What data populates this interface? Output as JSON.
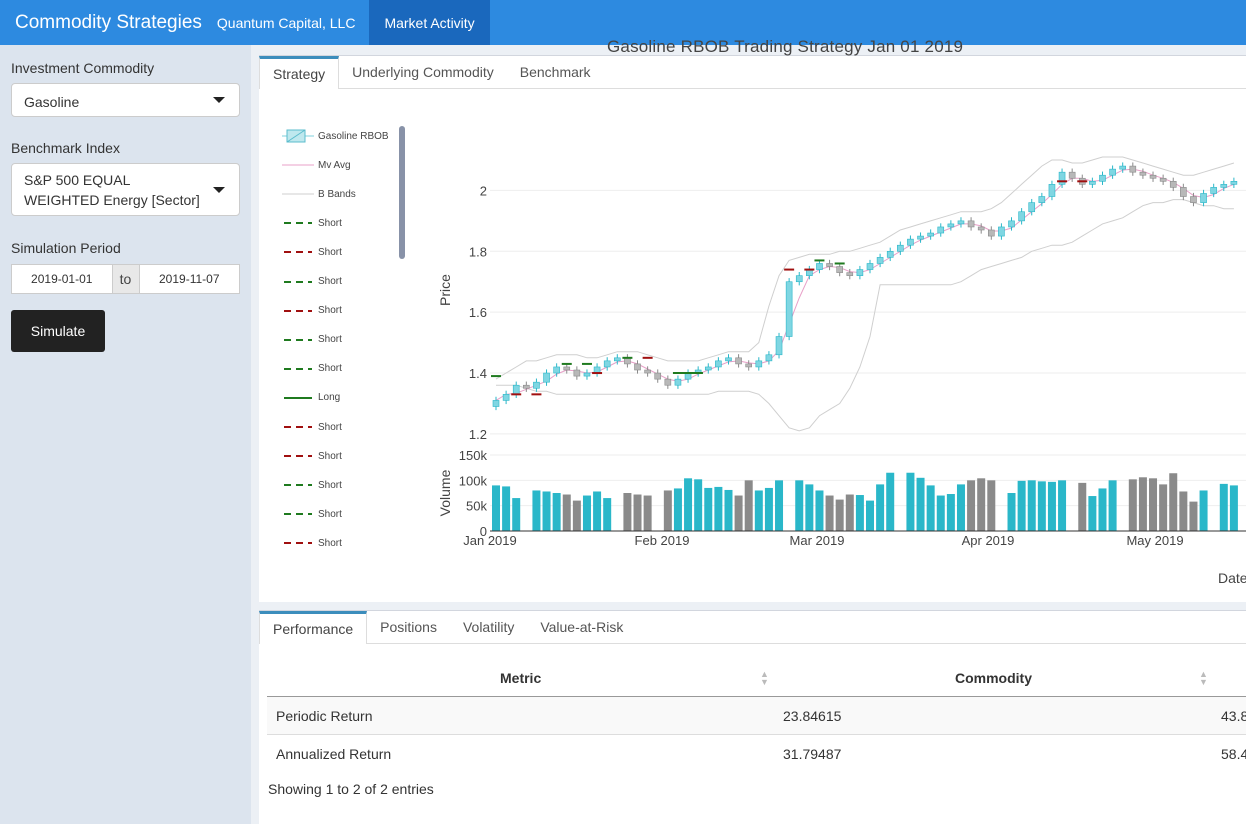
{
  "header": {
    "brand": "Commodity Strategies",
    "company": "Quantum Capital, LLC",
    "nav_active": "Market Activity"
  },
  "sidebar": {
    "commodity_label": "Investment Commodity",
    "commodity_value": "Gasoline",
    "benchmark_label": "Benchmark Index",
    "benchmark_value": "S&P 500 EQUAL WEIGHTED Energy [Sector]",
    "period_label": "Simulation Period",
    "start_date": "2019-01-01",
    "to_label": "to",
    "end_date": "2019-11-07",
    "simulate_label": "Simulate"
  },
  "chart_tabs": [
    "Strategy",
    "Underlying Commodity",
    "Benchmark"
  ],
  "chart_title": "Gasoline RBOB  Trading Strategy  Jan 01 2019",
  "legend": [
    {
      "label": "Gasoline RBOB",
      "style": "candle"
    },
    {
      "label": "Mv Avg",
      "style": "pink"
    },
    {
      "label": "B Bands",
      "style": "grey"
    },
    {
      "label": "Short",
      "style": "green-dash"
    },
    {
      "label": "Short",
      "style": "red-dash"
    },
    {
      "label": "Short",
      "style": "green-dash"
    },
    {
      "label": "Short",
      "style": "red-dash"
    },
    {
      "label": "Short",
      "style": "green-dash"
    },
    {
      "label": "Short",
      "style": "green-dash"
    },
    {
      "label": "Long",
      "style": "green-solid"
    },
    {
      "label": "Short",
      "style": "red-dash"
    },
    {
      "label": "Short",
      "style": "red-dash"
    },
    {
      "label": "Short",
      "style": "green-dash"
    },
    {
      "label": "Short",
      "style": "green-dash"
    },
    {
      "label": "Short",
      "style": "red-dash"
    }
  ],
  "chart_data": {
    "type": "candlestick",
    "ylabel": "Price",
    "volume_label": "Volume",
    "xlabel": "Date",
    "x_ticks": [
      "Jan 2019",
      "Feb 2019",
      "Mar 2019",
      "Apr 2019",
      "May 2019"
    ],
    "y_ticks": [
      "1.2",
      "1.4",
      "1.6",
      "1.8",
      "2"
    ],
    "ylim": [
      1.18,
      2.1
    ],
    "vol_ticks": [
      "0",
      "50k",
      "100k",
      "150k"
    ],
    "vol_ylim": [
      0,
      150000
    ],
    "colors": {
      "up": "#2ab7c9",
      "down": "#8a8a8a",
      "ma": "#e8a0c8",
      "band": "#cfcfcf",
      "short_green": "#1f7a1f",
      "short_red": "#a01010"
    },
    "close_series": [
      1.31,
      1.33,
      1.36,
      1.35,
      1.37,
      1.4,
      1.42,
      1.41,
      1.39,
      1.4,
      1.42,
      1.44,
      1.45,
      1.43,
      1.41,
      1.4,
      1.38,
      1.36,
      1.38,
      1.4,
      1.41,
      1.42,
      1.44,
      1.45,
      1.43,
      1.42,
      1.44,
      1.46,
      1.52,
      1.7,
      1.72,
      1.74,
      1.76,
      1.75,
      1.73,
      1.72,
      1.74,
      1.76,
      1.78,
      1.8,
      1.82,
      1.84,
      1.85,
      1.86,
      1.88,
      1.89,
      1.9,
      1.88,
      1.87,
      1.85,
      1.88,
      1.9,
      1.93,
      1.96,
      1.98,
      2.02,
      2.06,
      2.04,
      2.02,
      2.03,
      2.05,
      2.07,
      2.08,
      2.06,
      2.05,
      2.04,
      2.03,
      2.01,
      1.98,
      1.96,
      1.99,
      2.01,
      2.02,
      2.03
    ],
    "upper_band": [
      1.38,
      1.4,
      1.42,
      1.44,
      1.44,
      1.45,
      1.46,
      1.46,
      1.46,
      1.45,
      1.45,
      1.46,
      1.47,
      1.47,
      1.47,
      1.46,
      1.45,
      1.44,
      1.44,
      1.44,
      1.44,
      1.45,
      1.46,
      1.47,
      1.47,
      1.47,
      1.5,
      1.62,
      1.72,
      1.77,
      1.78,
      1.79,
      1.79,
      1.79,
      1.8,
      1.8,
      1.81,
      1.82,
      1.83,
      1.85,
      1.87,
      1.88,
      1.89,
      1.9,
      1.91,
      1.92,
      1.93,
      1.93,
      1.93,
      1.94,
      1.96,
      1.99,
      2.02,
      2.05,
      2.08,
      2.1,
      2.1,
      2.09,
      2.09,
      2.1,
      2.11,
      2.11,
      2.11,
      2.1,
      2.09,
      2.08,
      2.07,
      2.06,
      2.05,
      2.05,
      2.06,
      2.07,
      2.08,
      2.09
    ],
    "lower_band": [
      1.36,
      1.36,
      1.36,
      1.35,
      1.34,
      1.34,
      1.33,
      1.33,
      1.33,
      1.33,
      1.33,
      1.33,
      1.33,
      1.33,
      1.33,
      1.33,
      1.33,
      1.33,
      1.33,
      1.33,
      1.33,
      1.33,
      1.34,
      1.34,
      1.34,
      1.34,
      1.33,
      1.3,
      1.26,
      1.22,
      1.21,
      1.22,
      1.26,
      1.28,
      1.3,
      1.35,
      1.42,
      1.52,
      1.69,
      1.69,
      1.69,
      1.69,
      1.69,
      1.69,
      1.69,
      1.69,
      1.7,
      1.72,
      1.74,
      1.75,
      1.76,
      1.77,
      1.78,
      1.8,
      1.81,
      1.82,
      1.82,
      1.83,
      1.85,
      1.87,
      1.89,
      1.9,
      1.91,
      1.93,
      1.95,
      1.96,
      1.96,
      1.97,
      1.97,
      1.96,
      1.95,
      1.95,
      1.94,
      1.94
    ],
    "volume": [
      90000,
      88000,
      65000,
      0,
      80000,
      78000,
      75000,
      72000,
      60000,
      70000,
      78000,
      65000,
      0,
      75000,
      72000,
      70000,
      0,
      80000,
      84000,
      104000,
      102000,
      85000,
      87000,
      81000,
      70000,
      100000,
      80000,
      85000,
      100000,
      0,
      100000,
      92000,
      80000,
      70000,
      62000,
      72000,
      71000,
      60000,
      92000,
      115000,
      0,
      115000,
      105000,
      90000,
      70000,
      73000,
      92000,
      100000,
      104000,
      100000,
      0,
      75000,
      99000,
      100000,
      98000,
      97000,
      100000,
      0,
      95000,
      69000,
      84000,
      100000,
      0,
      102000,
      106000,
      104000,
      92000,
      114000,
      78000,
      58000,
      80000,
      0,
      93000,
      90000
    ]
  },
  "table_tabs": [
    "Performance",
    "Positions",
    "Volatility",
    "Value-at-Risk"
  ],
  "table": {
    "headers": [
      "Metric",
      "Commodity"
    ],
    "rows": [
      [
        "Periodic Return",
        "23.84615",
        "43.8"
      ],
      [
        "Annualized Return",
        "31.79487",
        "58.4"
      ]
    ],
    "info": "Showing 1 to 2 of 2 entries"
  }
}
